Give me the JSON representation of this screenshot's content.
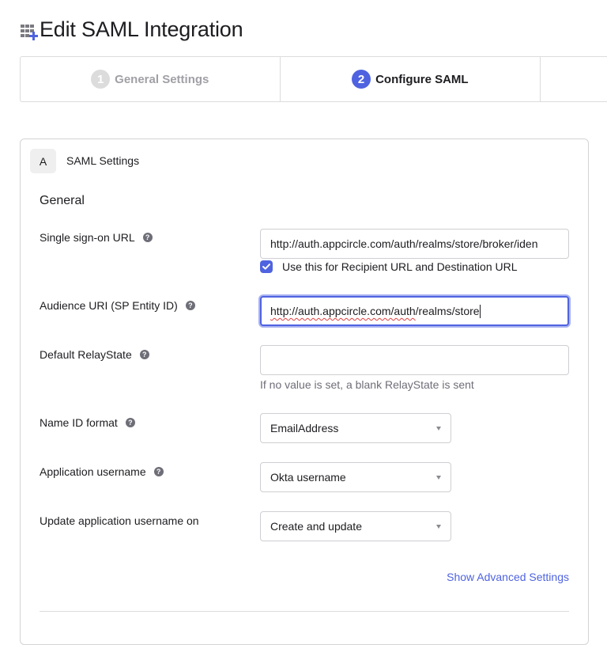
{
  "header": {
    "icon": "app-grid-plus-icon",
    "title": "Edit SAML Integration"
  },
  "stepper": {
    "steps": [
      {
        "number": "1",
        "label": "General Settings",
        "state": "completed"
      },
      {
        "number": "2",
        "label": "Configure SAML",
        "state": "active"
      },
      {
        "number": "",
        "label": "",
        "state": "upcoming"
      }
    ]
  },
  "panel": {
    "badge": "A",
    "title": "SAML Settings",
    "section_title": "General",
    "fields": {
      "sso_url": {
        "label": "Single sign-on URL",
        "value": "http://auth.appcircle.com/auth/realms/store/broker/iden",
        "checkbox_label": "Use this for Recipient URL and Destination URL",
        "checkbox_checked": true
      },
      "audience_uri": {
        "label": "Audience URI (SP Entity ID)",
        "value_underlined": "http://auth.appcircle.com/auth",
        "value_rest": "/realms/store"
      },
      "relay_state": {
        "label": "Default RelayState",
        "value": "",
        "hint": "If no value is set, a blank RelayState is sent"
      },
      "name_id_format": {
        "label": "Name ID format",
        "selected": "EmailAddress"
      },
      "app_username": {
        "label": "Application username",
        "selected": "Okta username"
      },
      "update_username_on": {
        "label": "Update application username on",
        "selected": "Create and update"
      }
    },
    "advanced_link": "Show Advanced Settings"
  },
  "colors": {
    "accent": "#4f63e0",
    "step_inactive": "#dcdcdc",
    "text": "#1d1d21",
    "muted": "#6e6e78"
  }
}
